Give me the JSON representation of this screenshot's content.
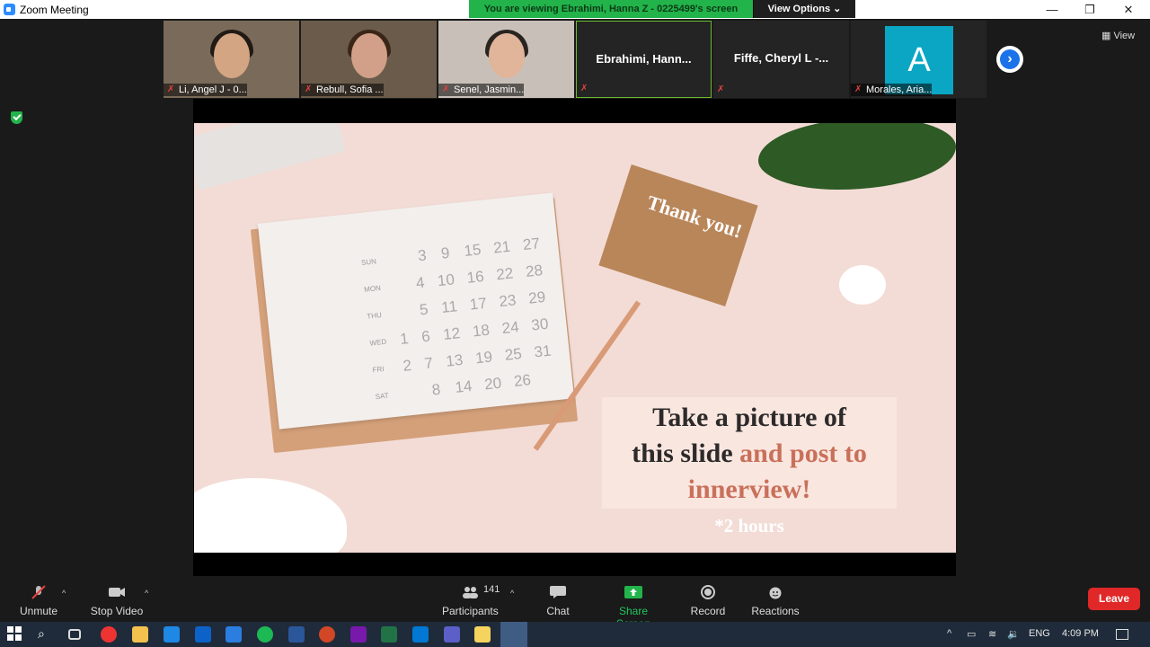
{
  "window": {
    "title": "Zoom Meeting"
  },
  "banner": {
    "text": "You are viewing Ebrahimi, Hanna Z - 0225499's screen",
    "view_options": "View Options ⌄"
  },
  "strip": {
    "participants": [
      {
        "name": "Li, Angel J - 0...",
        "type": "video"
      },
      {
        "name": "Rebull, Sofia ...",
        "type": "video"
      },
      {
        "name": "Senel, Jasmin...",
        "type": "video"
      },
      {
        "name": "Ebrahimi,  Hann...",
        "type": "name"
      },
      {
        "name": "Fiffe, Cheryl L -...",
        "type": "name"
      },
      {
        "name": "Morales, Aria...",
        "type": "avatar",
        "initial": "A"
      }
    ],
    "view_label": "View"
  },
  "slide": {
    "note": "Thank you!",
    "caption_line1": "Take a picture of",
    "caption_line2a": "this slide ",
    "caption_line2b": "and post to",
    "caption_line3": "innerview!",
    "footnote": "*2 hours",
    "calendar": {
      "days": [
        "SUN",
        "MON",
        "THU",
        "WED",
        "FRI",
        "SAT"
      ],
      "rows": [
        [
          "",
          "3",
          "9",
          "15",
          "21",
          "27"
        ],
        [
          "",
          "4",
          "10",
          "16",
          "22",
          "28"
        ],
        [
          "",
          "5",
          "11",
          "17",
          "23",
          "29"
        ],
        [
          "1",
          "6",
          "12",
          "18",
          "24",
          "30"
        ],
        [
          "2",
          "7",
          "13",
          "19",
          "25",
          "31"
        ],
        [
          "",
          "8",
          "14",
          "20",
          "26",
          ""
        ]
      ]
    }
  },
  "toolbar": {
    "unmute": "Unmute",
    "stop_video": "Stop Video",
    "participants": "Participants",
    "participants_count": "141",
    "chat": "Chat",
    "share_screen": "Share Screen",
    "record": "Record",
    "reactions": "Reactions",
    "leave": "Leave"
  },
  "taskbar": {
    "lang": "ENG",
    "time": "4:09 PM"
  },
  "colors": {
    "accent_green": "#22b34a",
    "leave_red": "#e02828",
    "slide_accent": "#c9705a"
  }
}
